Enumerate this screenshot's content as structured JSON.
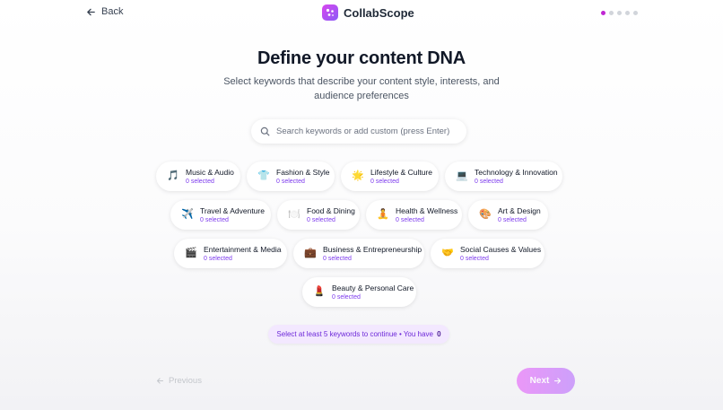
{
  "header": {
    "back_label": "Back",
    "brand_name": "CollabScope",
    "progress": {
      "total_steps": 5,
      "current_step": 1
    }
  },
  "main": {
    "title": "Define your content DNA",
    "subtitle": "Select keywords that describe your content style, interests, and audience preferences",
    "search_placeholder": "Search keywords or add custom (press Enter)",
    "search_value": ""
  },
  "categories": [
    {
      "icon": "🎵",
      "icon_name": "music-note-icon",
      "label": "Music & Audio",
      "count": "0 selected"
    },
    {
      "icon": "👕",
      "icon_name": "shirt-icon",
      "label": "Fashion & Style",
      "count": "0 selected"
    },
    {
      "icon": "🌟",
      "icon_name": "star-icon",
      "label": "Lifestyle & Culture",
      "count": "0 selected"
    },
    {
      "icon": "💻",
      "icon_name": "laptop-icon",
      "label": "Technology & Innovation",
      "count": "0 selected"
    },
    {
      "icon": "✈️",
      "icon_name": "airplane-icon",
      "label": "Travel & Adventure",
      "count": "0 selected"
    },
    {
      "icon": "🍽️",
      "icon_name": "plate-icon",
      "label": "Food & Dining",
      "count": "0 selected"
    },
    {
      "icon": "🧘",
      "icon_name": "meditation-icon",
      "label": "Health & Wellness",
      "count": "0 selected"
    },
    {
      "icon": "🎨",
      "icon_name": "palette-icon",
      "label": "Art & Design",
      "count": "0 selected"
    },
    {
      "icon": "🎬",
      "icon_name": "clapperboard-icon",
      "label": "Entertainment & Media",
      "count": "0 selected"
    },
    {
      "icon": "💼",
      "icon_name": "briefcase-icon",
      "label": "Business & Entrepreneurship",
      "count": "0 selected"
    },
    {
      "icon": "🤝",
      "icon_name": "handshake-icon",
      "label": "Social Causes & Values",
      "count": "0 selected"
    },
    {
      "icon": "💄",
      "icon_name": "lipstick-icon",
      "label": "Beauty & Personal Care",
      "count": "0 selected"
    }
  ],
  "notice": {
    "text": "Select at least 5 keywords to continue • You have",
    "count": "0"
  },
  "footer": {
    "previous_label": "Previous",
    "next_label": "Next"
  },
  "colors": {
    "accent": "#c026d3",
    "accent_secondary": "#8b5cf6",
    "count_text": "#7c3aed",
    "notice_bg": "#f3e8ff"
  }
}
